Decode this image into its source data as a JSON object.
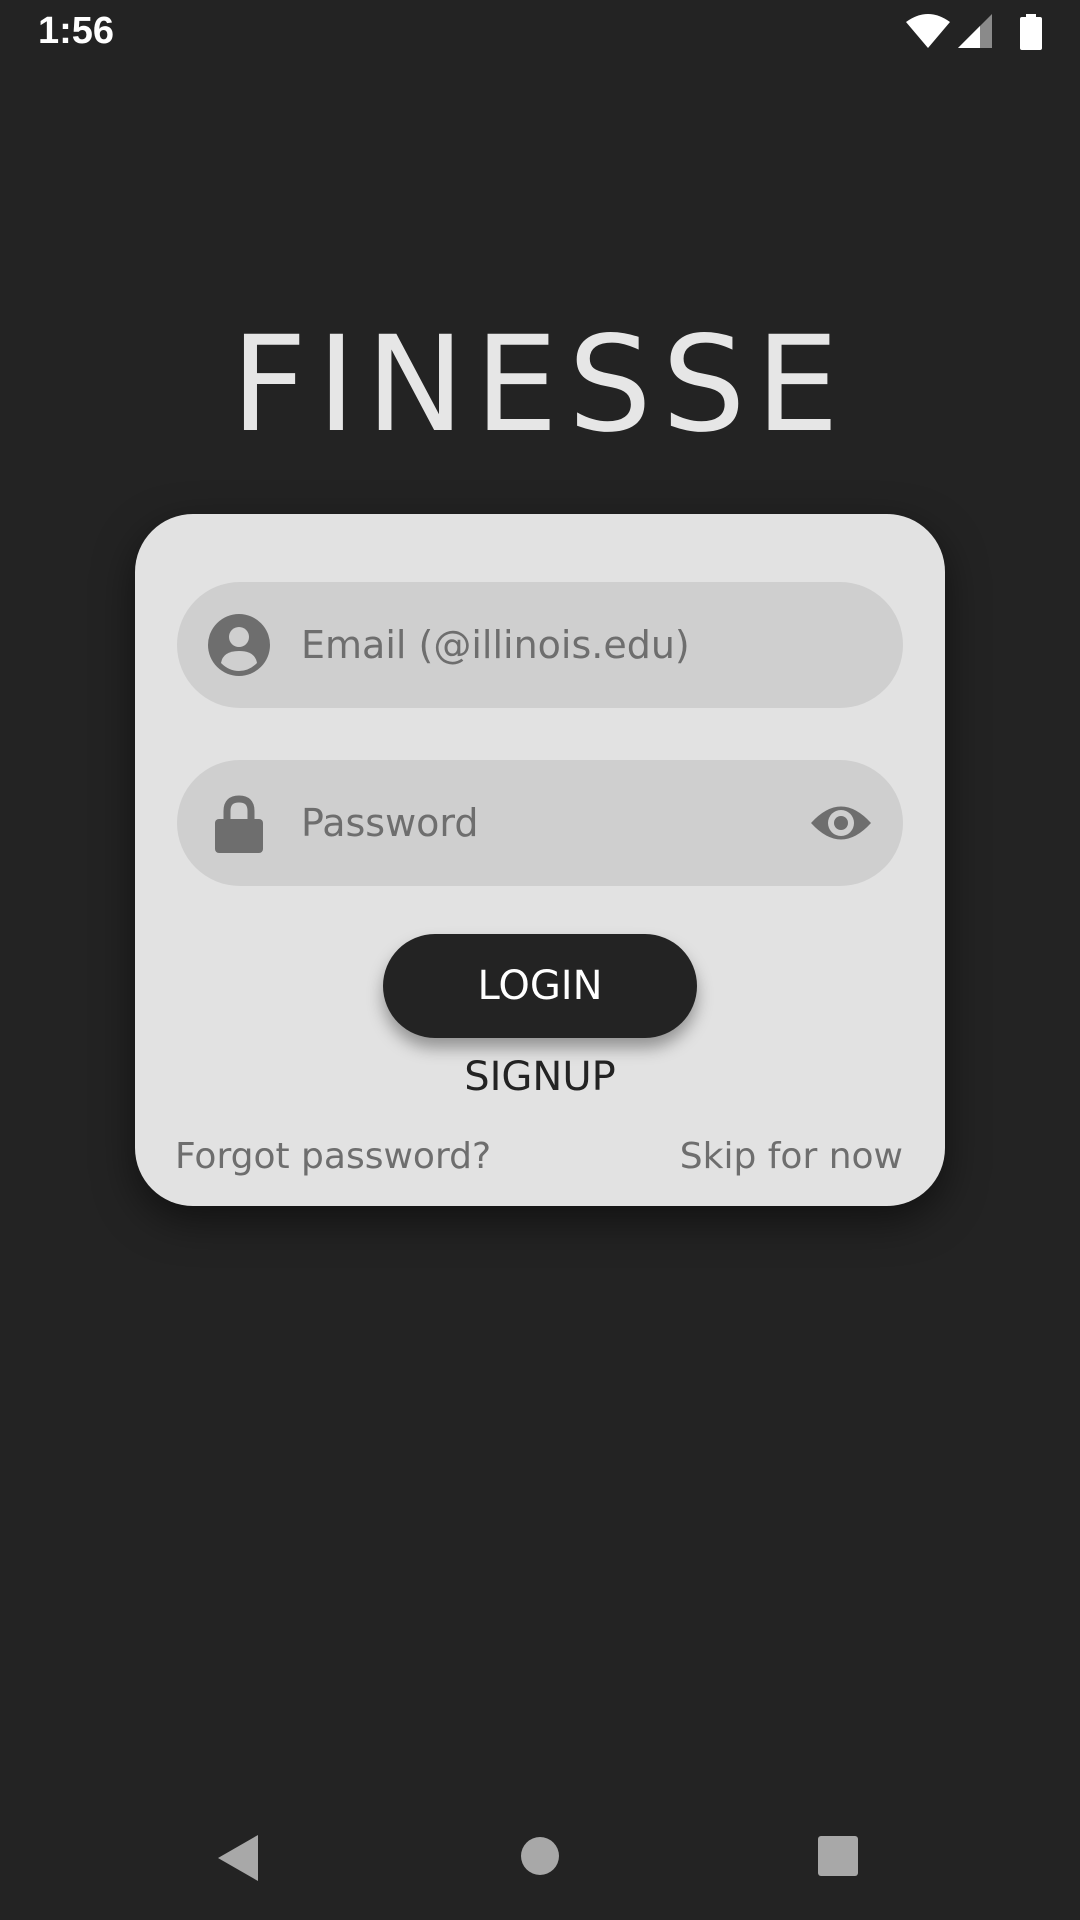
{
  "status_bar": {
    "time": "1:56",
    "icons": [
      "wifi-icon",
      "signal-icon",
      "battery-icon"
    ]
  },
  "app": {
    "title": "FINESSE"
  },
  "login_form": {
    "email_placeholder": "Email (@illinois.edu)",
    "password_placeholder": "Password",
    "login_label": "LOGIN",
    "signup_label": "SIGNUP",
    "forgot_label": "Forgot password?",
    "skip_label": "Skip for now"
  },
  "nav_bar": {
    "icons": [
      "back-icon",
      "home-icon",
      "recents-icon"
    ]
  },
  "colors": {
    "background": "#232323",
    "card": "#e2e2e2",
    "field": "#cfcfcf",
    "muted_text": "#6e6e6e",
    "button": "#232323"
  }
}
